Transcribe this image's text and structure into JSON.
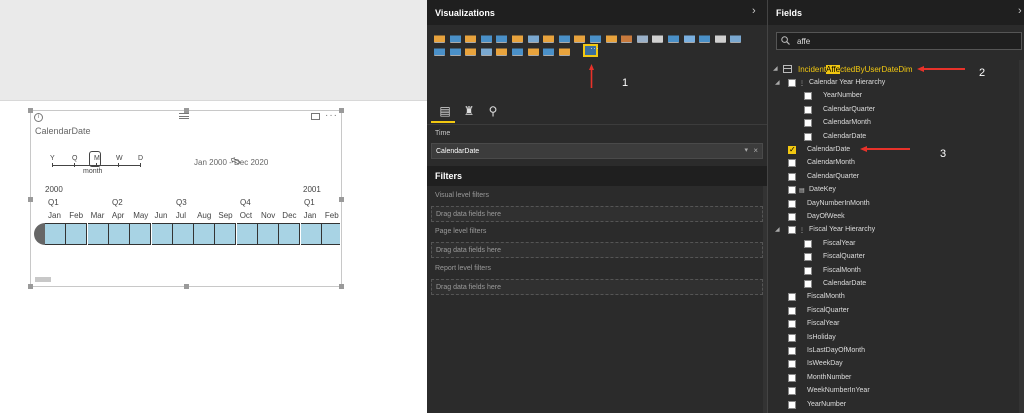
{
  "canvas": {
    "visual": {
      "title": "CalendarDate",
      "info_glyph": "i",
      "more_glyph": "···",
      "granularity": {
        "levels": [
          "Y",
          "Q",
          "M",
          "W",
          "D"
        ],
        "selected": "M",
        "caption": "month"
      },
      "range_label": "Jan 2000 - Dec 2020",
      "years": [
        "2000",
        "2001"
      ],
      "quarters": [
        "Q1",
        "Q2",
        "Q3",
        "Q4",
        "Q1"
      ],
      "months": [
        "Jan",
        "Feb",
        "Mar",
        "Apr",
        "May",
        "Jun",
        "Jul",
        "Aug",
        "Sep",
        "Oct",
        "Nov",
        "Dec",
        "Jan",
        "Feb"
      ]
    }
  },
  "visualizations": {
    "title": "Visualizations",
    "expand_glyph": "›",
    "icon_rows": [
      [
        "stacked-bar-icon",
        "stacked-column-icon",
        "clustered-bar-icon",
        "clustered-column-icon",
        "100-stacked-bar-icon",
        "100-stacked-column-icon",
        "line-chart-icon",
        "area-chart-icon",
        "stacked-area-icon",
        "line-column-icon",
        "line-clustered-column-icon",
        "ribbon-chart-icon",
        "waterfall-icon",
        "scatter-icon",
        "pie-icon",
        "donut-icon",
        "treemap-icon",
        "map-icon",
        "table-icon",
        "matrix-icon"
      ],
      [
        "funnel-icon",
        "gauge-icon",
        "r-visual-icon",
        "card-icon",
        "multi-row-card-icon",
        "kpi-icon",
        "globe-icon",
        "r-script-icon",
        "hierarchy-slicer-icon",
        "timeline-slicer-icon",
        "more-visuals-icon"
      ]
    ],
    "more_glyph": "···",
    "annotation_1": "1",
    "tabs": [
      "fields-tab",
      "format-tab",
      "analytics-tab"
    ],
    "time_label": "Time",
    "time_value": "CalendarDate",
    "time_dropdown_glyph": "▾",
    "time_remove_glyph": "×",
    "filters_title": "Filters",
    "filters": [
      {
        "label": "Visual level filters",
        "drop": "Drag data fields here"
      },
      {
        "label": "Page level filters",
        "drop": "Drag data fields here"
      },
      {
        "label": "Report level filters",
        "drop": "Drag data fields here"
      }
    ]
  },
  "fields": {
    "title": "Fields",
    "expand_glyph": "›",
    "search_value": "affe",
    "table": {
      "name_before": "Incident",
      "name_highlight": "Affe",
      "name_after": "ctedByUserDateDim",
      "collapse_glyph": "◢"
    },
    "annotation_2": "2",
    "annotation_3": "3",
    "collapse_glyph": "◢",
    "items": [
      {
        "label": "Calendar Year Hierarchy",
        "kind": "hierarchy",
        "depth": 0,
        "checked": false,
        "icon": "⋮",
        "tri": true
      },
      {
        "label": "YearNumber",
        "kind": "level",
        "depth": 1,
        "checked": false
      },
      {
        "label": "CalendarQuarter",
        "kind": "level",
        "depth": 1,
        "checked": false
      },
      {
        "label": "CalendarMonth",
        "kind": "level",
        "depth": 1,
        "checked": false
      },
      {
        "label": "CalendarDate",
        "kind": "level",
        "depth": 1,
        "checked": false
      },
      {
        "label": "CalendarDate",
        "kind": "field",
        "depth": 0,
        "checked": true
      },
      {
        "label": "CalendarMonth",
        "kind": "field",
        "depth": 0,
        "checked": false
      },
      {
        "label": "CalendarQuarter",
        "kind": "field",
        "depth": 0,
        "checked": false
      },
      {
        "label": "DateKey",
        "kind": "field",
        "depth": 0,
        "checked": false,
        "icon": "▤"
      },
      {
        "label": "DayNumberInMonth",
        "kind": "field",
        "depth": 0,
        "checked": false
      },
      {
        "label": "DayOfWeek",
        "kind": "field",
        "depth": 0,
        "checked": false
      },
      {
        "label": "Fiscal Year Hierarchy",
        "kind": "hierarchy",
        "depth": 0,
        "checked": false,
        "icon": "⋮",
        "tri": true
      },
      {
        "label": "FiscalYear",
        "kind": "level",
        "depth": 1,
        "checked": false
      },
      {
        "label": "FiscalQuarter",
        "kind": "level",
        "depth": 1,
        "checked": false
      },
      {
        "label": "FiscalMonth",
        "kind": "level",
        "depth": 1,
        "checked": false
      },
      {
        "label": "CalendarDate",
        "kind": "level",
        "depth": 1,
        "checked": false
      },
      {
        "label": "FiscalMonth",
        "kind": "field",
        "depth": 0,
        "checked": false
      },
      {
        "label": "FiscalQuarter",
        "kind": "field",
        "depth": 0,
        "checked": false
      },
      {
        "label": "FiscalYear",
        "kind": "field",
        "depth": 0,
        "checked": false
      },
      {
        "label": "IsHoliday",
        "kind": "field",
        "depth": 0,
        "checked": false
      },
      {
        "label": "IsLastDayOfMonth",
        "kind": "field",
        "depth": 0,
        "checked": false
      },
      {
        "label": "IsWeekDay",
        "kind": "field",
        "depth": 0,
        "checked": false
      },
      {
        "label": "MonthNumber",
        "kind": "field",
        "depth": 0,
        "checked": false
      },
      {
        "label": "WeekNumberInYear",
        "kind": "field",
        "depth": 0,
        "checked": false
      },
      {
        "label": "YearNumber",
        "kind": "field",
        "depth": 0,
        "checked": false
      }
    ]
  },
  "colors": {
    "accent": "#f2c811",
    "annotation_red": "#e8322a",
    "timeline_fill": "#a8d3e4",
    "pane_bg": "#2b2b2b"
  }
}
